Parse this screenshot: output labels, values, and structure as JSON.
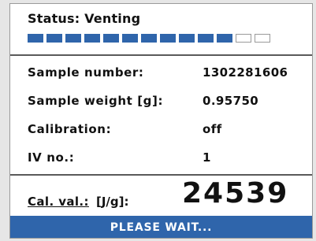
{
  "status": {
    "label": "Status: Venting",
    "progress": {
      "filled_segments": 11,
      "total_segments": 13
    }
  },
  "fields": [
    {
      "label": "Sample number:",
      "value": "1302281606"
    },
    {
      "label": "Sample weight [g]:",
      "value": "0.95750"
    },
    {
      "label": "Calibration:",
      "value": "off"
    },
    {
      "label": "IV no.:",
      "value": "1"
    }
  ],
  "calibration": {
    "label": "Cal. val.:",
    "unit": "[J/g]:",
    "value": "24539"
  },
  "footer": {
    "message": "PLEASE WAIT..."
  },
  "colors": {
    "accent": "#2f65ab",
    "background": "#ffffff"
  }
}
